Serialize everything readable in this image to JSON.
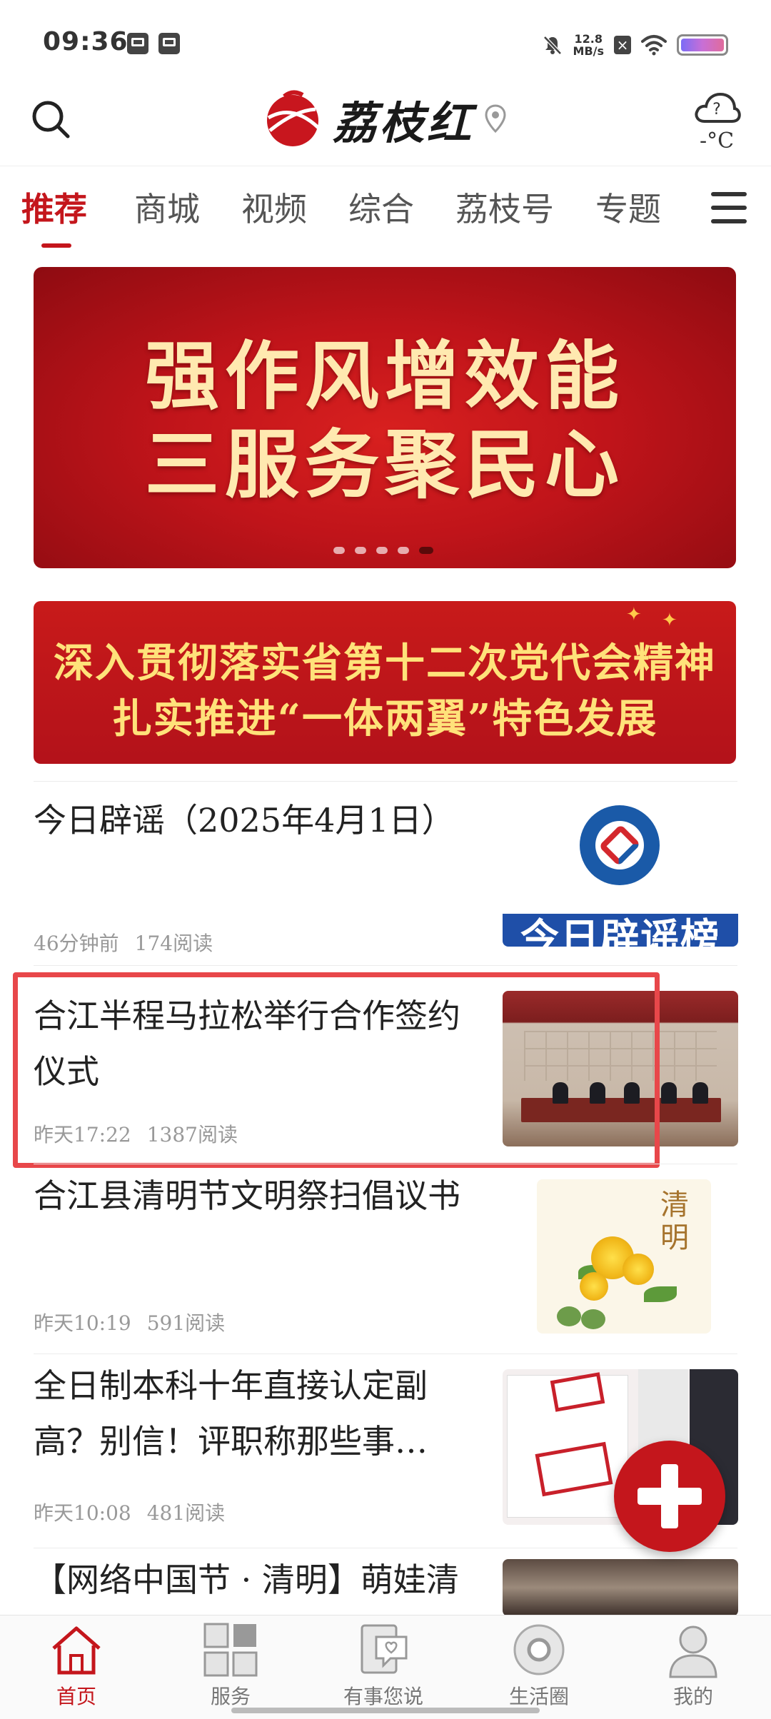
{
  "status_bar": {
    "time": "09:36",
    "net_speed_value": "12.8",
    "net_speed_unit": "MB/s"
  },
  "header": {
    "app_name": "荔枝红",
    "temperature": "-°C"
  },
  "tabs": [
    {
      "label": "推荐",
      "active": true
    },
    {
      "label": "商城"
    },
    {
      "label": "视频"
    },
    {
      "label": "综合"
    },
    {
      "label": "荔枝号"
    },
    {
      "label": "专题"
    }
  ],
  "banner_carousel": {
    "line1": "强作风增效能",
    "line2": "三服务聚民心",
    "slide_count": 5,
    "active_slide": 5
  },
  "banner_secondary": {
    "line1": "深入贯彻落实省第十二次党代会精神",
    "line2": "扎实推进“一体两翼”特色发展"
  },
  "news": [
    {
      "title": "今日辟谣（2025年4月1日）",
      "time": "46分钟前",
      "reads": "174阅读",
      "thumb_text": "今日辟谣榜"
    },
    {
      "title": "合江半程马拉松举行合作签约仪式",
      "time": "昨天17:22",
      "reads": "1387阅读"
    },
    {
      "title": "合江县清明节文明祭扫倡议书",
      "time": "昨天10:19",
      "reads": "591阅读",
      "thumb_text": "清明"
    },
    {
      "title": "全日制本科十年直接认定副高？别信！评职称那些事…",
      "time": "昨天10:08",
      "reads": "481阅读"
    },
    {
      "title": "【网络中国节 · 清明】萌娃清"
    }
  ],
  "bottom_nav": [
    {
      "label": "首页",
      "icon": "home-icon",
      "active": true
    },
    {
      "label": "服务",
      "icon": "grid-icon"
    },
    {
      "label": "有事您说",
      "icon": "message-heart-icon"
    },
    {
      "label": "生活圈",
      "icon": "circle-icon"
    },
    {
      "label": "我的",
      "icon": "user-icon"
    }
  ],
  "colors": {
    "accent": "#c4161c",
    "highlight_box": "#e8474a"
  }
}
